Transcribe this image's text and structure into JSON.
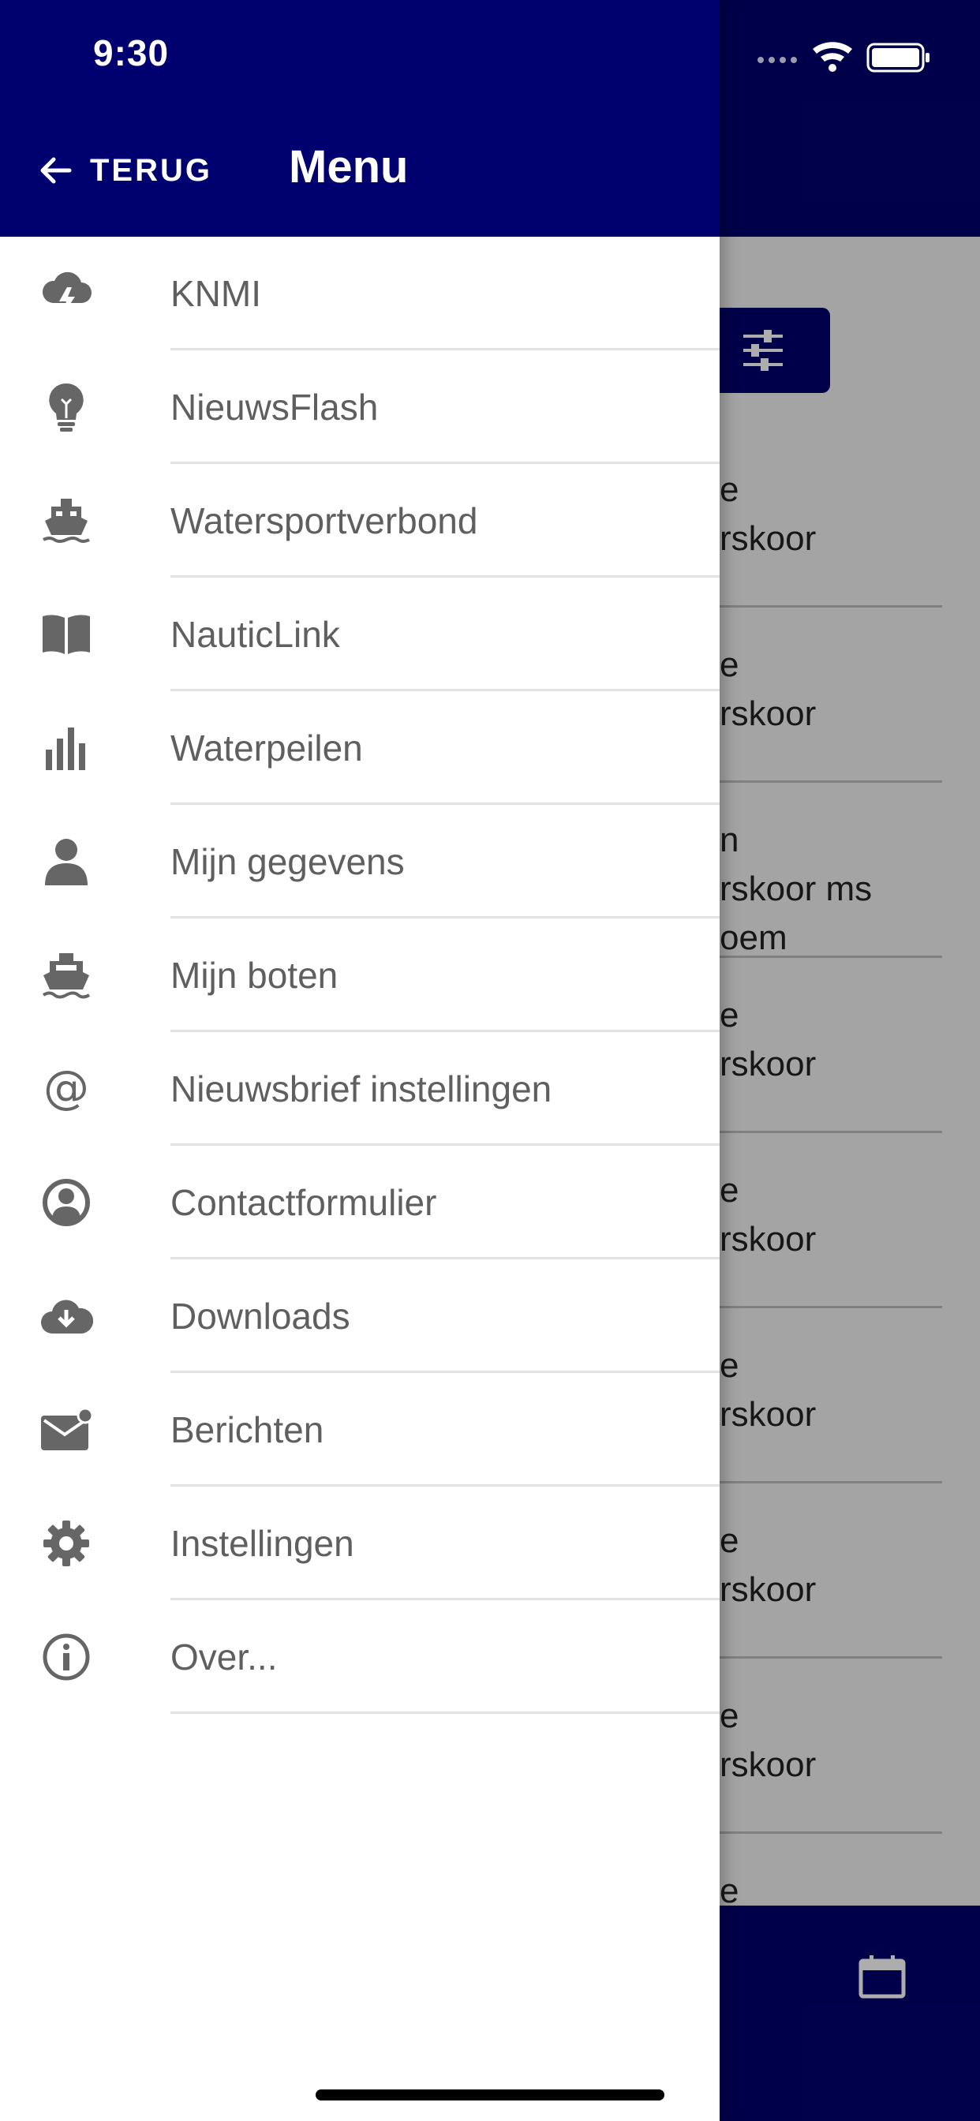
{
  "status_bar": {
    "time": "9:30"
  },
  "header": {
    "back_label": "TERUG",
    "title": "Menu"
  },
  "menu": {
    "items": [
      {
        "label": "KNMI",
        "icon": "weather-storm-icon"
      },
      {
        "label": "NieuwsFlash",
        "icon": "lightbulb-icon"
      },
      {
        "label": "Watersportverbond",
        "icon": "boat-icon"
      },
      {
        "label": "NauticLink",
        "icon": "book-icon"
      },
      {
        "label": "Waterpeilen",
        "icon": "bar-chart-icon"
      },
      {
        "label": "Mijn gegevens",
        "icon": "person-icon"
      },
      {
        "label": "Mijn boten",
        "icon": "ship-icon"
      },
      {
        "label": "Nieuwsbrief instellingen",
        "icon": "at-icon"
      },
      {
        "label": "Contactformulier",
        "icon": "account-circle-icon"
      },
      {
        "label": "Downloads",
        "icon": "cloud-download-icon"
      },
      {
        "label": "Berichten",
        "icon": "mail-badge-icon"
      },
      {
        "label": "Instellingen",
        "icon": "gear-icon"
      },
      {
        "label": "Over...",
        "icon": "info-icon"
      }
    ]
  },
  "background_list": {
    "rows": [
      [
        "e",
        "rskoor"
      ],
      [
        "e",
        "rskoor"
      ],
      [
        "n",
        "rskoor ms",
        "oem"
      ],
      [
        "e",
        "rskoor"
      ],
      [
        "e",
        "rskoor"
      ],
      [
        "e",
        "rskoor"
      ],
      [
        "e",
        "rskoor"
      ],
      [
        "e",
        "rskoor"
      ],
      [
        "e"
      ]
    ]
  },
  "colors": {
    "primary": "#00006e",
    "menu_text": "#5f5f5f",
    "icon": "#666666"
  }
}
